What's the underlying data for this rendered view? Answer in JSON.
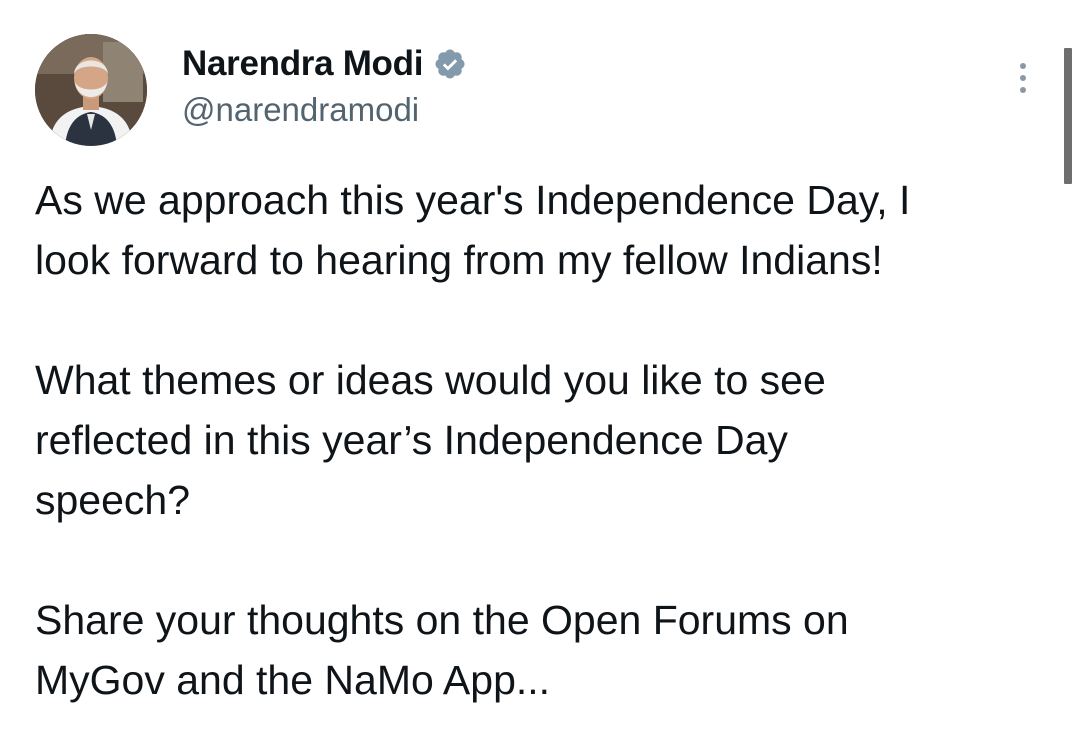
{
  "tweet": {
    "author": {
      "display_name": "Narendra Modi",
      "handle": "@narendramodi",
      "verified": true,
      "avatar": "profile-photo"
    },
    "menu_icon": "more-vertical-icon",
    "paragraphs": [
      "As we approach this year's Independence Day, I\nlook forward to hearing from my fellow Indians!",
      "What themes or ideas would you like to see\nreflected in this year’s Independence Day\nspeech?",
      "Share your thoughts on the Open Forums on\nMyGov and the NaMo App..."
    ]
  },
  "colors": {
    "text_primary": "#0f1419",
    "text_secondary": "#536471",
    "verified_badge": "#829aab",
    "background": "#ffffff"
  }
}
